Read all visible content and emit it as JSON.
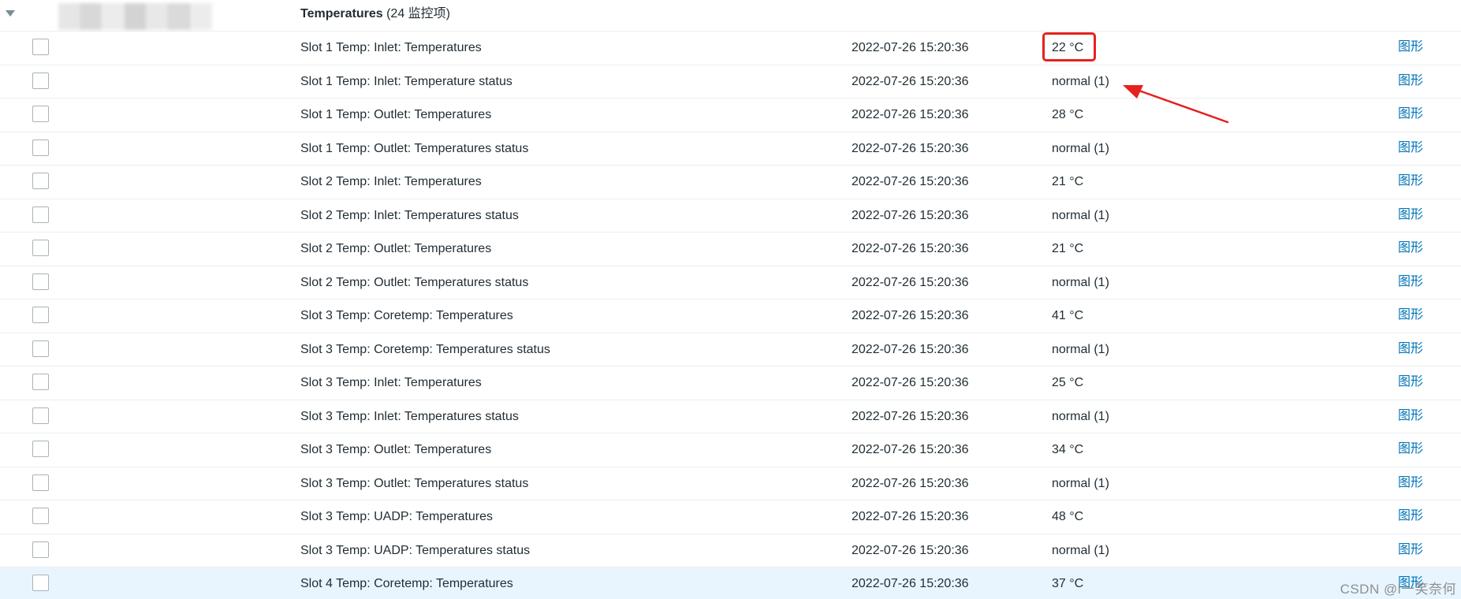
{
  "group": {
    "name": "Temperatures",
    "count_label": "(24 监控项)"
  },
  "colors": {
    "link": "#0275b8",
    "text": "#1f2c33",
    "row_border": "#ebeef0",
    "highlight_row": "#e8f5ff",
    "annotation": "#e5211d"
  },
  "icons": {
    "toggle": "triangle-down-icon",
    "annotation_arrow": "red-arrow-icon"
  },
  "items": [
    {
      "name": "Slot 1 Temp: Inlet: Temperatures",
      "last_check": "2022-07-26 15:20:36",
      "last_value": "22 °C",
      "action": "图形"
    },
    {
      "name": "Slot 1 Temp: Inlet: Temperature status",
      "last_check": "2022-07-26 15:20:36",
      "last_value": "normal (1)",
      "action": "图形"
    },
    {
      "name": "Slot 1 Temp: Outlet: Temperatures",
      "last_check": "2022-07-26 15:20:36",
      "last_value": "28 °C",
      "action": "图形"
    },
    {
      "name": "Slot 1 Temp: Outlet: Temperatures status",
      "last_check": "2022-07-26 15:20:36",
      "last_value": "normal (1)",
      "action": "图形"
    },
    {
      "name": "Slot 2 Temp: Inlet: Temperatures",
      "last_check": "2022-07-26 15:20:36",
      "last_value": "21 °C",
      "action": "图形"
    },
    {
      "name": "Slot 2 Temp: Inlet: Temperatures status",
      "last_check": "2022-07-26 15:20:36",
      "last_value": "normal (1)",
      "action": "图形"
    },
    {
      "name": "Slot 2 Temp: Outlet: Temperatures",
      "last_check": "2022-07-26 15:20:36",
      "last_value": "21 °C",
      "action": "图形"
    },
    {
      "name": "Slot 2 Temp: Outlet: Temperatures status",
      "last_check": "2022-07-26 15:20:36",
      "last_value": "normal (1)",
      "action": "图形"
    },
    {
      "name": "Slot 3 Temp: Coretemp: Temperatures",
      "last_check": "2022-07-26 15:20:36",
      "last_value": "41 °C",
      "action": "图形"
    },
    {
      "name": "Slot 3 Temp: Coretemp: Temperatures status",
      "last_check": "2022-07-26 15:20:36",
      "last_value": "normal (1)",
      "action": "图形"
    },
    {
      "name": "Slot 3 Temp: Inlet: Temperatures",
      "last_check": "2022-07-26 15:20:36",
      "last_value": "25 °C",
      "action": "图形"
    },
    {
      "name": "Slot 3 Temp: Inlet: Temperatures status",
      "last_check": "2022-07-26 15:20:36",
      "last_value": "normal (1)",
      "action": "图形"
    },
    {
      "name": "Slot 3 Temp: Outlet: Temperatures",
      "last_check": "2022-07-26 15:20:36",
      "last_value": "34 °C",
      "action": "图形"
    },
    {
      "name": "Slot 3 Temp: Outlet: Temperatures status",
      "last_check": "2022-07-26 15:20:36",
      "last_value": "normal (1)",
      "action": "图形"
    },
    {
      "name": "Slot 3 Temp: UADP: Temperatures",
      "last_check": "2022-07-26 15:20:36",
      "last_value": "48 °C",
      "action": "图形"
    },
    {
      "name": "Slot 3 Temp: UADP: Temperatures status",
      "last_check": "2022-07-26 15:20:36",
      "last_value": "normal (1)",
      "action": "图形"
    },
    {
      "name": "Slot 4 Temp: Coretemp: Temperatures",
      "last_check": "2022-07-26 15:20:36",
      "last_value": "37 °C",
      "action": "图形",
      "highlighted": true
    }
  ],
  "annotation": {
    "boxed_row_index": 0
  },
  "watermark": "CSDN @i一笑奈何"
}
